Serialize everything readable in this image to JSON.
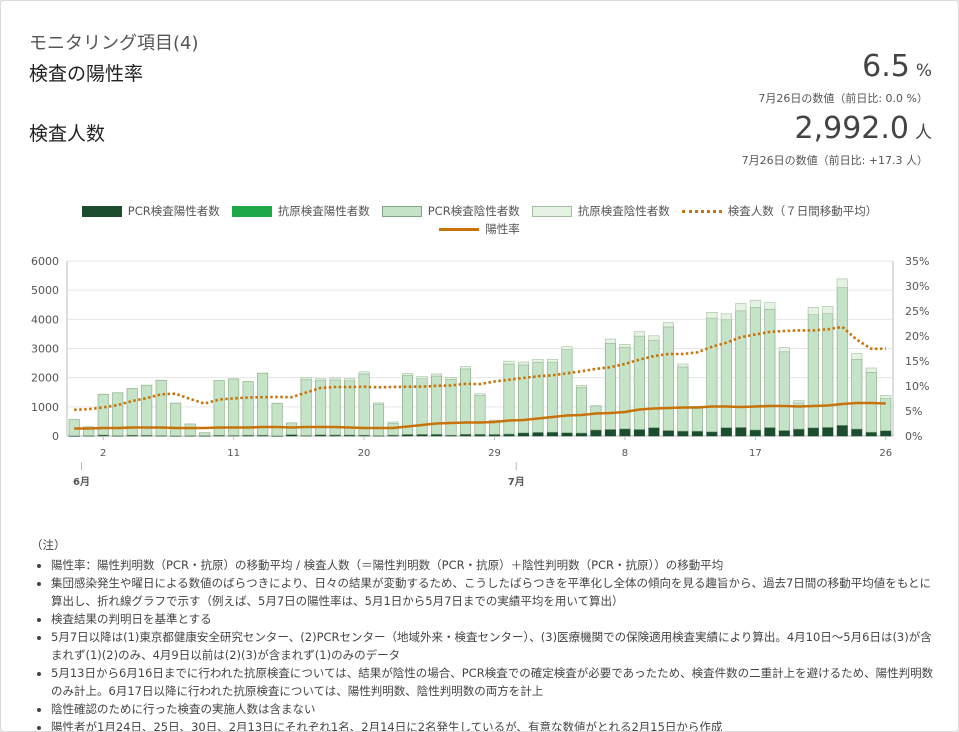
{
  "header": {
    "subtitle": "モニタリング項目(4)",
    "metric1": {
      "title": "検査の陽性率",
      "value": "6.5",
      "unit": "%",
      "note": "7月26日の数値（前日比: 0.0 %）"
    },
    "metric2": {
      "title": "検査人数",
      "value": "2,992.0",
      "unit": "人",
      "note": "7月26日の数値（前日比: +17.3 人）"
    }
  },
  "colors": {
    "pcr_positive": "#1b4d2e",
    "antigen_positive": "#1fa84a",
    "pcr_negative": "#c5e3c6",
    "antigen_negative": "#e6f3e4",
    "test_avg": "#c8730a",
    "positive_rate": "#c8730a"
  },
  "legend": [
    {
      "label": "PCR検査陽性者数",
      "icon": "pcr-positive-swatch"
    },
    {
      "label": "抗原検査陽性者数",
      "icon": "antigen-positive-swatch"
    },
    {
      "label": "PCR検査陰性者数",
      "icon": "pcr-negative-swatch"
    },
    {
      "label": "抗原検査陰性者数",
      "icon": "antigen-negative-swatch"
    },
    {
      "label": "検査人数（７日間移動平均）",
      "icon": "dotted-line-swatch"
    },
    {
      "label": "陽性率",
      "icon": "solid-line-swatch"
    }
  ],
  "chart_data": {
    "type": "bar",
    "stacked": true,
    "x_tick_labels": [
      "2",
      "11",
      "20",
      "29",
      "8",
      "17",
      "26"
    ],
    "month_labels": [
      "6月",
      "7月"
    ],
    "y_left": {
      "ticks": [
        "0",
        "1000",
        "2000",
        "3000",
        "4000",
        "5000",
        "6000"
      ],
      "range": [
        0,
        6000
      ]
    },
    "y_right": {
      "ticks": [
        "0%",
        "5%",
        "10%",
        "15%",
        "20%",
        "25%",
        "30%",
        "35%"
      ],
      "range": [
        0,
        35
      ]
    },
    "grid": true,
    "legend_position": "top",
    "x": [
      "5/31",
      "6/1",
      "6/2",
      "6/3",
      "6/4",
      "6/5",
      "6/6",
      "6/7",
      "6/8",
      "6/9",
      "6/10",
      "6/11",
      "6/12",
      "6/13",
      "6/14",
      "6/15",
      "6/16",
      "6/17",
      "6/18",
      "6/19",
      "6/20",
      "6/21",
      "6/22",
      "6/23",
      "6/24",
      "6/25",
      "6/26",
      "6/27",
      "6/28",
      "6/29",
      "6/30",
      "7/1",
      "7/2",
      "7/3",
      "7/4",
      "7/5",
      "7/6",
      "7/7",
      "7/8",
      "7/9",
      "7/10",
      "7/11",
      "7/12",
      "7/13",
      "7/14",
      "7/15",
      "7/16",
      "7/17",
      "7/18",
      "7/19",
      "7/20",
      "7/21",
      "7/22",
      "7/23",
      "7/24",
      "7/25",
      "7/26"
    ],
    "series": [
      {
        "name": "PCR検査陽性者数",
        "values": [
          5,
          13,
          34,
          12,
          28,
          24,
          14,
          8,
          13,
          12,
          22,
          18,
          27,
          26,
          5,
          48,
          16,
          41,
          35,
          35,
          29,
          14,
          31,
          54,
          55,
          57,
          29,
          60,
          58,
          54,
          67,
          107,
          124,
          131,
          111,
          102,
          206,
          224,
          243,
          224,
          286,
          188,
          168,
          165,
          143,
          286,
          293,
          206,
          290,
          188,
          237,
          280,
          295,
          366,
          239,
          131,
          182
        ]
      },
      {
        "name": "抗原検査陽性者数",
        "values": [
          0,
          0,
          0,
          0,
          0,
          0,
          0,
          0,
          0,
          0,
          0,
          0,
          0,
          0,
          0,
          0,
          0,
          0,
          0,
          0,
          0,
          0,
          0,
          0,
          0,
          0,
          0,
          0,
          0,
          0,
          0,
          0,
          0,
          0,
          0,
          0,
          0,
          0,
          0,
          0,
          0,
          0,
          0,
          0,
          0,
          0,
          0,
          0,
          0,
          0,
          0,
          0,
          0,
          0,
          0,
          0,
          0
        ]
      },
      {
        "name": "PCR検査陰性者数",
        "values": [
          560,
          300,
          1400,
          1470,
          1600,
          1720,
          1900,
          1120,
          400,
          100,
          1880,
          1940,
          1840,
          2130,
          1120,
          400,
          1930,
          1860,
          1890,
          1860,
          2100,
          1080,
          400,
          2020,
          1910,
          2000,
          1910,
          2240,
          1330,
          460,
          2400,
          2330,
          2400,
          2400,
          2850,
          1570,
          800,
          2950,
          2800,
          3200,
          3000,
          3550,
          2200,
          800,
          3900,
          3700,
          4000,
          4200,
          4050,
          2700,
          900,
          3880,
          3900,
          4720,
          2390,
          2050,
          1100
        ]
      },
      {
        "name": "抗原検査陰性者数",
        "values": [
          0,
          0,
          0,
          0,
          0,
          0,
          0,
          0,
          0,
          0,
          0,
          0,
          0,
          0,
          0,
          0,
          60,
          60,
          70,
          70,
          70,
          40,
          50,
          70,
          70,
          70,
          70,
          80,
          60,
          30,
          100,
          100,
          100,
          100,
          100,
          60,
          40,
          150,
          100,
          150,
          150,
          150,
          100,
          50,
          200,
          200,
          250,
          250,
          230,
          150,
          80,
          250,
          250,
          300,
          200,
          150,
          110
        ]
      },
      {
        "name": "検査人数（７日間移動平均）",
        "values": [
          900,
          920,
          980,
          1060,
          1200,
          1300,
          1430,
          1450,
          1270,
          1110,
          1250,
          1290,
          1320,
          1330,
          1340,
          1330,
          1490,
          1650,
          1680,
          1680,
          1690,
          1670,
          1680,
          1690,
          1690,
          1720,
          1730,
          1790,
          1780,
          1870,
          1930,
          1990,
          2050,
          2080,
          2150,
          2220,
          2300,
          2360,
          2470,
          2620,
          2740,
          2810,
          2810,
          2870,
          3060,
          3200,
          3390,
          3480,
          3570,
          3600,
          3620,
          3620,
          3660,
          3740,
          3300,
          2990,
          2992
        ]
      },
      {
        "name": "陽性率",
        "values": [
          1.5,
          1.5,
          1.6,
          1.6,
          1.7,
          1.7,
          1.7,
          1.6,
          1.6,
          1.6,
          1.7,
          1.7,
          1.7,
          1.8,
          1.8,
          1.7,
          1.8,
          1.8,
          1.8,
          1.7,
          1.6,
          1.6,
          1.6,
          1.9,
          2.2,
          2.5,
          2.6,
          2.7,
          2.7,
          2.8,
          3.1,
          3.2,
          3.5,
          3.8,
          4.1,
          4.2,
          4.5,
          4.6,
          4.8,
          5.3,
          5.5,
          5.6,
          5.7,
          5.7,
          5.9,
          5.9,
          5.8,
          5.9,
          6.0,
          6.0,
          5.9,
          6.0,
          6.1,
          6.4,
          6.6,
          6.6,
          6.5
        ]
      }
    ]
  },
  "notes": {
    "title": "（注）",
    "items": [
      "陽性率：陽性判明数（PCR・抗原）の移動平均 / 検査人数（＝陽性判明数（PCR・抗原）＋陰性判明数（PCR・抗原））の移動平均",
      "集団感染発生や曜日による数値のばらつきにより、日々の結果が変動するため、こうしたばらつきを平準化し全体の傾向を見る趣旨から、過去7日間の移動平均値をもとに算出し、折れ線グラフで示す（例えば、5月7日の陽性率は、5月1日から5月7日までの実績平均を用いて算出）",
      "検査結果の判明日を基準とする",
      "5月7日以降は(1)東京都健康安全研究センター、(2)PCRセンター（地域外来・検査センター）、(3)医療機関での保険適用検査実績により算出。4月10日～5月6日は(3)が含まれず(1)(2)のみ、4月9日以前は(2)(3)が含まれず(1)のみのデータ",
      "5月13日から6月16日までに行われた抗原検査については、結果が陰性の場合、PCR検査での確定検査が必要であったため、検査件数の二重計上を避けるため、陽性判明数のみ計上。6月17日以降に行われた抗原検査については、陽性判明数、陰性判明数の両方を計上",
      "陰性確認のために行った検査の実施人数は含まない",
      "陽性者が1月24日、25日、30日、2月13日にそれぞれ1名、2月14日に2名発生しているが、有意な数値がとれる2月15日から作成"
    ]
  }
}
